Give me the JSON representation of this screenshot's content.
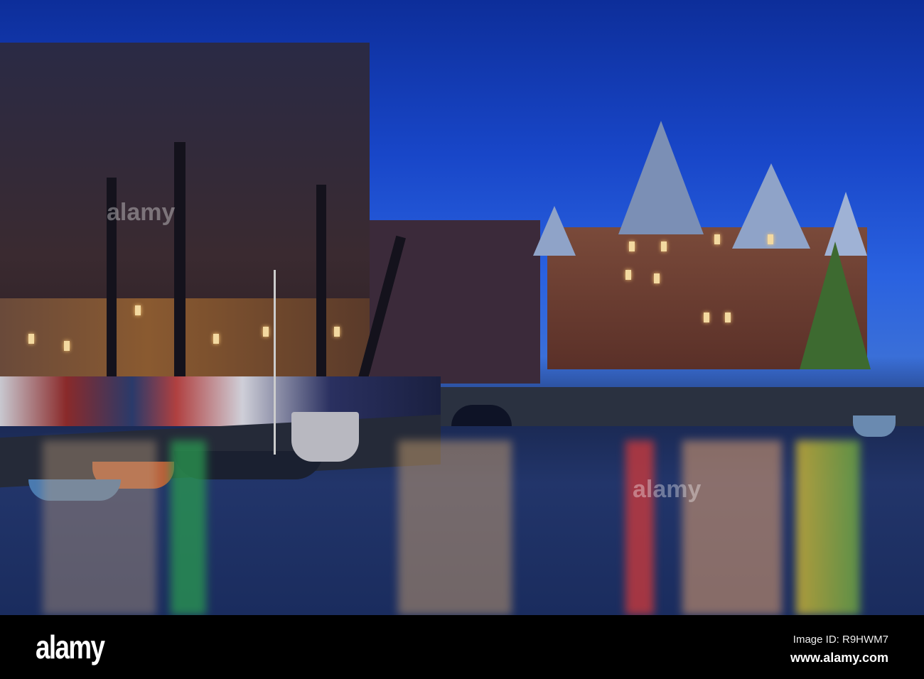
{
  "watermark": {
    "logo": "alamy",
    "image_id": "Image ID: R9HWM7",
    "site": "www.alamy.com"
  },
  "colors": {
    "sky": "#1846c8",
    "water": "#1b2a55",
    "building": "#6b3a2e",
    "footer": "#000000"
  }
}
